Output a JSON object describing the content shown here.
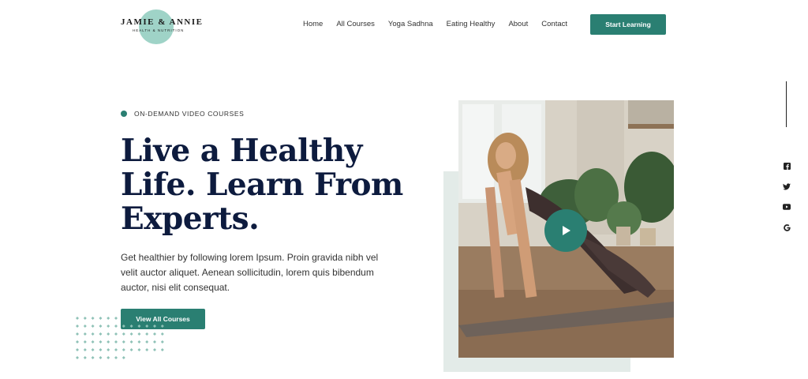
{
  "brand": {
    "name": "JAMIE & ANNIE",
    "tagline": "HEALTH & NUTRITION"
  },
  "nav": {
    "items": [
      {
        "label": "Home"
      },
      {
        "label": "All Courses"
      },
      {
        "label": "Yoga Sadhna"
      },
      {
        "label": "Eating Healthy"
      },
      {
        "label": "About"
      },
      {
        "label": "Contact"
      }
    ],
    "cta_label": "Start Learning"
  },
  "hero": {
    "eyebrow": "ON-DEMAND VIDEO COURSES",
    "headline": "Live a Healthy Life. Learn From Experts.",
    "description": "Get healthier by following lorem Ipsum. Proin gravida nibh vel velit auctor aliquet. Aenean sollicitudin, lorem quis bibendum auctor, nisi elit consequat.",
    "button_label": "View All Courses"
  },
  "media": {
    "image": "woman-doing-yoga-photo",
    "play_icon": "play-icon"
  },
  "social": [
    "facebook-icon",
    "twitter-icon",
    "youtube-icon",
    "google-icon"
  ],
  "colors": {
    "accent": "#2a7f72",
    "heading": "#0d1b3e",
    "logo_circle": "#9fd3c7",
    "image_backdrop": "#e3ebe8"
  }
}
